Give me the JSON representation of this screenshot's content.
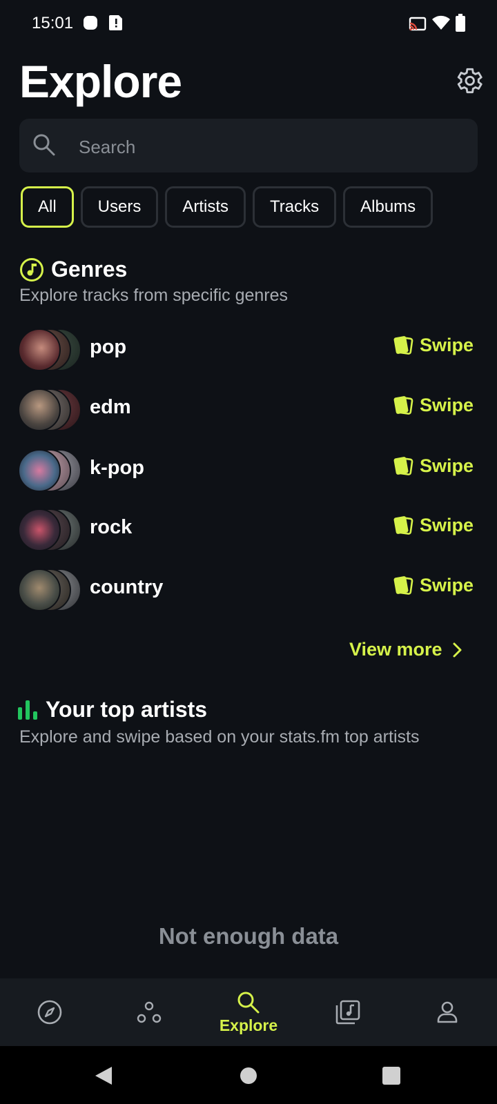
{
  "status_bar": {
    "time": "15:01"
  },
  "header": {
    "title": "Explore"
  },
  "search": {
    "placeholder": "Search"
  },
  "filters": [
    {
      "label": "All",
      "active": true
    },
    {
      "label": "Users",
      "active": false
    },
    {
      "label": "Artists",
      "active": false
    },
    {
      "label": "Tracks",
      "active": false
    },
    {
      "label": "Albums",
      "active": false
    }
  ],
  "genres_section": {
    "title": "Genres",
    "subtitle": "Explore tracks from specific genres",
    "items": [
      {
        "name": "pop",
        "action": "Swipe"
      },
      {
        "name": "edm",
        "action": "Swipe"
      },
      {
        "name": "k-pop",
        "action": "Swipe"
      },
      {
        "name": "rock",
        "action": "Swipe"
      },
      {
        "name": "country",
        "action": "Swipe"
      }
    ],
    "view_more": "View more"
  },
  "top_artists_section": {
    "title": "Your top artists",
    "subtitle": "Explore and swipe based on your stats.fm top artists",
    "empty_message": "Not enough data"
  },
  "bottom_nav": [
    {
      "icon": "compass-icon",
      "label": ""
    },
    {
      "icon": "social-nodes-icon",
      "label": ""
    },
    {
      "icon": "search-icon",
      "label": "Explore",
      "active": true
    },
    {
      "icon": "music-library-icon",
      "label": ""
    },
    {
      "icon": "profile-icon",
      "label": ""
    }
  ],
  "colors": {
    "accent": "#d6f24a",
    "background": "#0e1116",
    "surface": "#1a1e24",
    "muted_text": "#a8acb2"
  }
}
